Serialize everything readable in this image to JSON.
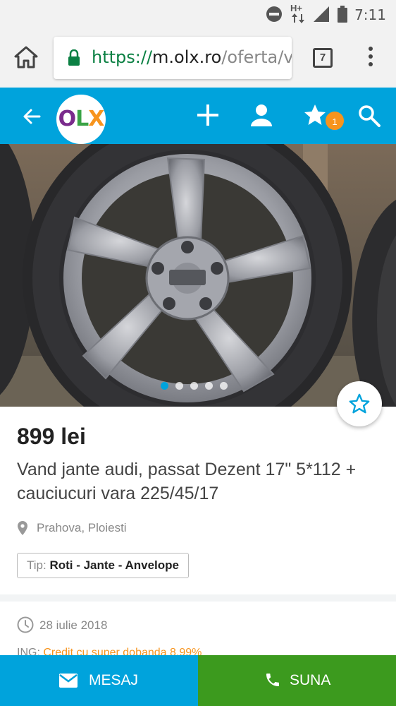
{
  "status_bar": {
    "time": "7:11",
    "network_label": "H+"
  },
  "browser": {
    "url_scheme": "https://",
    "url_host": "m.olx.ro",
    "url_path": "/oferta/v",
    "tab_count": "7"
  },
  "header": {
    "logo_o": "O",
    "logo_l": "L",
    "logo_x": "X",
    "favorites_badge": "1",
    "brand_color": "#00a3dc"
  },
  "gallery": {
    "photo_count": 5,
    "active_index": 0
  },
  "listing": {
    "price": "899 lei",
    "title": "Vand jante audi, passat Dezent 17\" 5*112 + cauciucuri vara 225/45/17",
    "location": "Prahova, Ploiesti",
    "type_prefix": "Tip:",
    "type_value": "Roti - Jante - Anvelope",
    "date": "28 iulie 2018",
    "promo_prefix": "ING:",
    "promo_link": "Credit cu super dobanda 8,99%"
  },
  "actions": {
    "message_label": "MESAJ",
    "call_label": "SUNA"
  }
}
